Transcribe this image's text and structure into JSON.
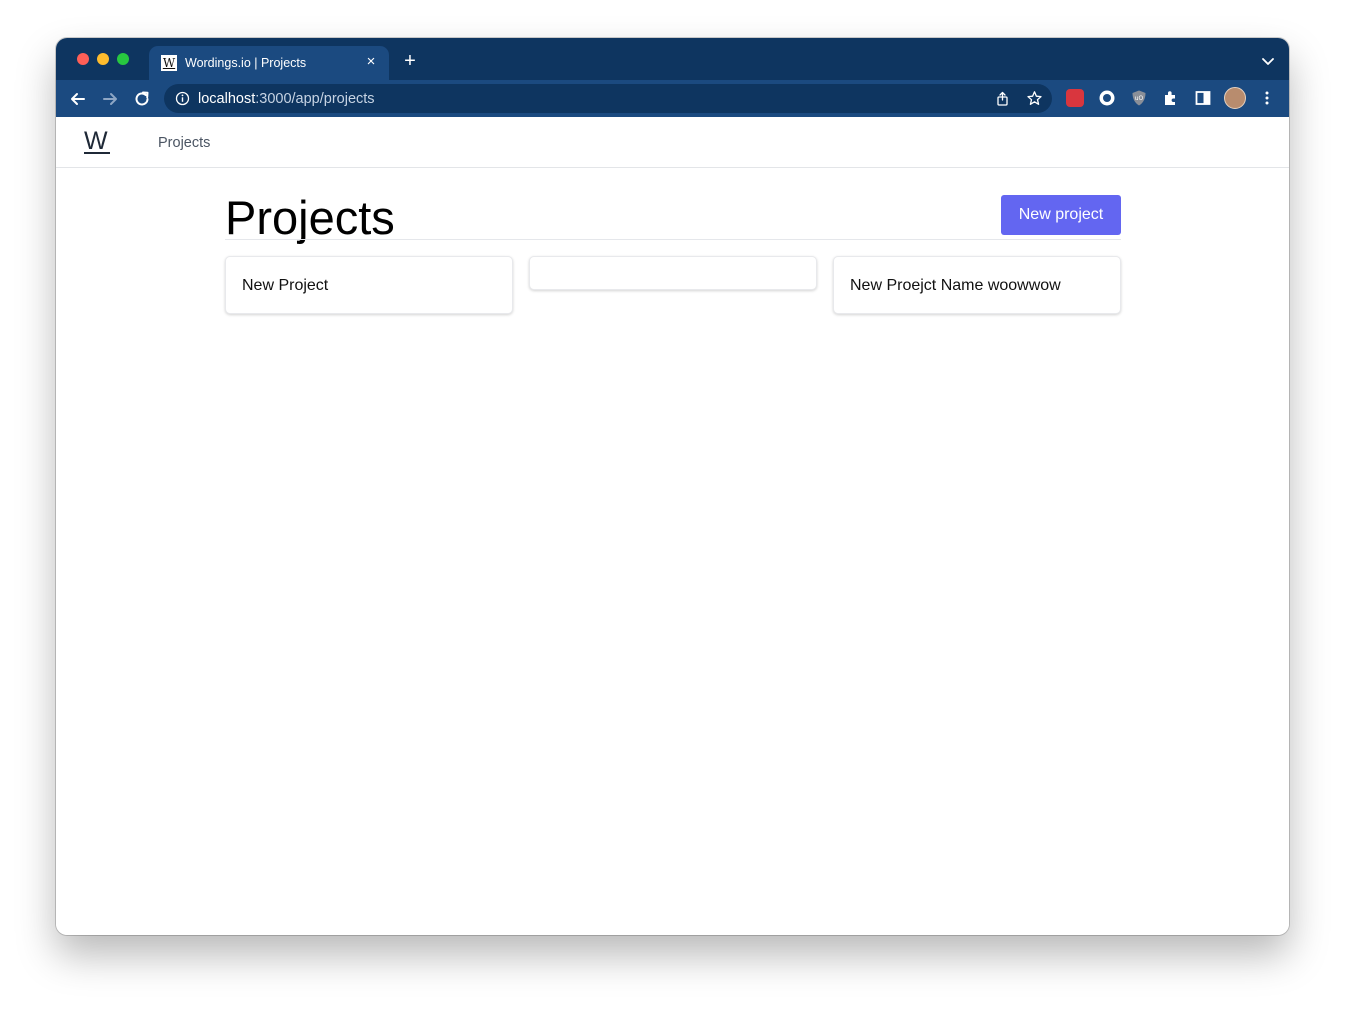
{
  "browser": {
    "tab": {
      "title": "Wordings.io | Projects",
      "favicon_letter": "W"
    },
    "new_tab_label": "+",
    "close_label": "×",
    "url": {
      "host": "localhost",
      "path": ":3000/app/projects"
    }
  },
  "app": {
    "logo": "W",
    "nav": {
      "projects": "Projects"
    },
    "heading": "Projects",
    "new_project_button": "New project",
    "projects": [
      {
        "name": "New Project"
      },
      {
        "name": ""
      },
      {
        "name": "New Proejct Name woowwow"
      }
    ]
  },
  "colors": {
    "tabstrip": "#0e3560",
    "toolbar": "#1b4a80",
    "accent": "#6366f1"
  },
  "icons": [
    "back-icon",
    "forward-icon",
    "reload-icon",
    "info-icon",
    "share-icon",
    "star-icon",
    "extensions-icon",
    "side-panel-icon",
    "menu-icon"
  ]
}
